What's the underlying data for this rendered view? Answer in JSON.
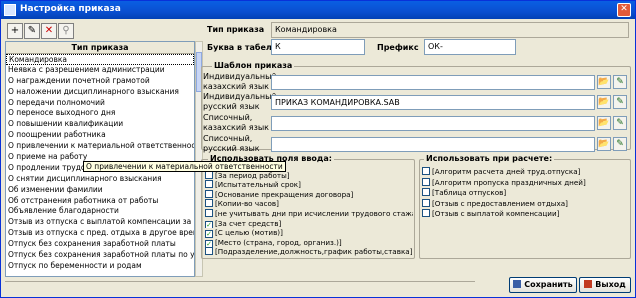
{
  "window": {
    "title": "Настройка приказа",
    "close_glyph": "✕"
  },
  "toolbar": {
    "buttons": [
      {
        "icon": "plus-icon",
        "glyph": "+"
      },
      {
        "icon": "edit-icon",
        "glyph": "✎"
      },
      {
        "icon": "delete-icon",
        "glyph": "✕"
      },
      {
        "icon": "binoculars-icon",
        "glyph": "⚲"
      }
    ]
  },
  "list": {
    "header": "Тип приказа",
    "selected_index": 0,
    "items": [
      "Командировка",
      "Неявка с разрешением администрации",
      "О награждении почетной грамотой",
      "О наложении дисциплинарного взыскания",
      "О передачи полномочий",
      "О переносе выходного дня",
      "О повышении квалификации",
      "О поощрении работника",
      "О привлечении к материальной ответственности",
      "О приеме на работу",
      "О продлении трудового отпуска",
      "О снятии дисциплинарного взыскания",
      "Об изменении фамилии",
      "Об отстранения работника от работы",
      "Объявление благодарности",
      "Отзыв из отпуска с выплатой компенсации за не",
      "Отзыв из отпуска с пред. отдыха в другое время",
      "Отпуск без сохранения заработной платы",
      "Отпуск без сохранения заработной платы по ух",
      "Отпуск по беременности и родам"
    ],
    "tooltip": "О привлечении к материальной ответственности"
  },
  "form": {
    "type_label": "Тип приказа",
    "type_value": "Командировка",
    "letter_label": "Буква в табеле",
    "letter_value": "К",
    "prefix_label": "Префикс",
    "prefix_value": "ОК-",
    "template_title": "Шаблон приказа",
    "templates": [
      {
        "label": "Индивидуальный, казахский язык",
        "value": ""
      },
      {
        "label": "Индивидуальный, русский язык",
        "value": "ПРИКАЗ КОМАНДИРОВКА.SAB"
      },
      {
        "label": "Списочный, казахский язык",
        "value": ""
      },
      {
        "label": "Списочный, русский язык",
        "value": ""
      }
    ],
    "open_glyph": "📂",
    "edit_glyph": "✎"
  },
  "fields": {
    "title": "Использовать поля ввода:",
    "items": [
      {
        "label": "[Причина неявки]",
        "checked": false
      },
      {
        "label": "[За период работы]",
        "checked": false
      },
      {
        "label": "[Испытательный срок]",
        "checked": false
      },
      {
        "label": "[Основание прекращения договора]",
        "checked": false
      },
      {
        "label": "[Копии-во часов]",
        "checked": false
      },
      {
        "label": "[не учитывать дни при исчислении трудового стажа д",
        "checked": false
      },
      {
        "label": "[За счет средств]",
        "checked": true
      },
      {
        "label": "[С целью (мотив)]",
        "checked": true
      },
      {
        "label": "[Место (страна, город, организ.)]",
        "checked": true
      },
      {
        "label": "[Подразделение,должность,график работы,ставка]",
        "checked": false
      }
    ]
  },
  "calc": {
    "title": "Использовать при расчете:",
    "items": [
      {
        "label": "[Алгоритм расчета дней труд.отпуска]",
        "checked": false
      },
      {
        "label": "[Алгоритм пропуска праздничных дней]",
        "checked": false
      },
      {
        "label": "[Таблица отпусков]",
        "checked": false
      },
      {
        "label": "[Отзыв с предоставлением отдыха]",
        "checked": false
      },
      {
        "label": "[Отзыв с выплатой компенсации]",
        "checked": false
      }
    ]
  },
  "buttons": {
    "save": "Сохранить",
    "exit": "Выход"
  }
}
